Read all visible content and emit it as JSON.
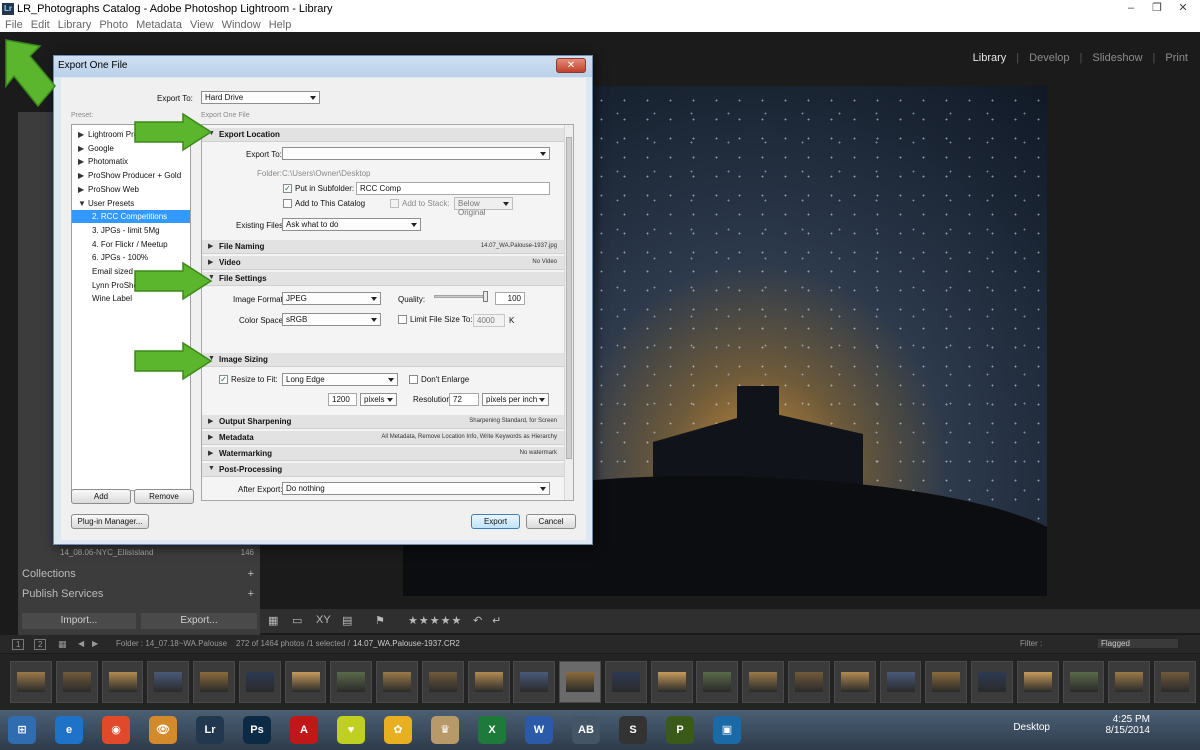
{
  "window": {
    "title": "LR_Photographs Catalog - Adobe Photoshop Lightroom - Library",
    "app_icon": "Lr",
    "controls": [
      "–",
      "❐",
      "✕"
    ]
  },
  "menubar": [
    "File",
    "Edit",
    "Library",
    "Photo",
    "Metadata",
    "View",
    "Window",
    "Help"
  ],
  "modules": {
    "items": [
      "Library",
      "Develop",
      "Slideshow",
      "Print"
    ],
    "active": "Library"
  },
  "left_panel": {
    "folder_name": "14_08.06-NYC_EllisIsland",
    "folder_count": "146",
    "collections_label": "Collections",
    "publish_label": "Publish Services",
    "import_label": "Import...",
    "export_label": "Export..."
  },
  "toolbar": {
    "rating": "★★★★★"
  },
  "filmstrip": {
    "page1": "1",
    "page2": "2",
    "source": "Folder : 14_07.18~WA.Palouse",
    "info": "272 of 1464 photos /1 selected /",
    "selected_file": "14.07_WA.Palouse-1937.CR2",
    "filter_label": "Filter :",
    "filter_value": "Flagged",
    "thumb_count": 26
  },
  "dialog": {
    "title": "Export One File",
    "close": "✕",
    "export_to_label": "Export To:",
    "export_to_value": "Hard Drive",
    "preset_label": "Preset:",
    "settings_caption": "Export One File",
    "presets": [
      {
        "label": "Lightroom Presets",
        "tri": "▶",
        "level": 0
      },
      {
        "label": "Google",
        "tri": "▶",
        "level": 0
      },
      {
        "label": "Photomatix",
        "tri": "▶",
        "level": 0
      },
      {
        "label": "ProShow Producer + Gold",
        "tri": "▶",
        "level": 0
      },
      {
        "label": "ProShow Web",
        "tri": "▶",
        "level": 0
      },
      {
        "label": "User Presets",
        "tri": "▼",
        "level": 0
      },
      {
        "label": "2. RCC Competitions",
        "tri": "",
        "level": 1,
        "selected": true
      },
      {
        "label": "3. JPGs - limit 5Mg",
        "tri": "",
        "level": 1
      },
      {
        "label": "4. For Flickr / Meetup",
        "tri": "",
        "level": 1
      },
      {
        "label": "6. JPGs - 100%",
        "tri": "",
        "level": 1
      },
      {
        "label": "Email sized",
        "tri": "",
        "level": 1
      },
      {
        "label": "Lynn ProShow",
        "tri": "",
        "level": 1
      },
      {
        "label": "Wine Label",
        "tri": "",
        "level": 1
      }
    ],
    "add_label": "Add",
    "remove_label": "Remove",
    "plugin_label": "Plug-in Manager...",
    "export_btn": "Export",
    "cancel_btn": "Cancel",
    "sections": {
      "export_location": {
        "title": "Export Location",
        "export_to_label": "Export To:",
        "folder_label": "Folder:",
        "folder_value": "C:\\Users\\Owner\\Desktop",
        "subfolder_label": "Put in Subfolder:",
        "subfolder_value": "RCC Comp",
        "add_catalog_label": "Add to This Catalog",
        "add_stack_label": "Add to Stack:",
        "stack_value": "Below Original",
        "existing_label": "Existing Files:",
        "existing_value": "Ask what to do"
      },
      "file_naming": {
        "title": "File Naming",
        "summary": "14.07_WA.Palouse-1937.jpg"
      },
      "video": {
        "title": "Video",
        "summary": "No Video"
      },
      "file_settings": {
        "title": "File Settings",
        "format_label": "Image Format:",
        "format_value": "JPEG",
        "quality_label": "Quality:",
        "quality_value": "100",
        "colorspace_label": "Color Space:",
        "colorspace_value": "sRGB",
        "limit_label": "Limit File Size To:",
        "limit_value": "4000",
        "limit_unit": "K"
      },
      "image_sizing": {
        "title": "Image Sizing",
        "resize_label": "Resize to Fit:",
        "resize_value": "Long Edge",
        "enlarge_label": "Don't Enlarge",
        "size_value": "1200",
        "size_unit": "pixels",
        "resolution_label": "Resolution:",
        "resolution_value": "72",
        "resolution_unit": "pixels per inch"
      },
      "output_sharpening": {
        "title": "Output Sharpening",
        "summary": "Sharpening Standard, for Screen"
      },
      "metadata": {
        "title": "Metadata",
        "summary": "All Metadata, Remove Location Info, Write Keywords as Hierarchy"
      },
      "watermarking": {
        "title": "Watermarking",
        "summary": "No watermark"
      },
      "post_processing": {
        "title": "Post-Processing",
        "after_label": "After Export:",
        "after_value": "Do nothing"
      }
    }
  },
  "taskbar": {
    "desktop_label": "Desktop",
    "time": "4:25 PM",
    "date": "8/15/2014",
    "icons": [
      "⊞",
      "e",
      "◉",
      "👁",
      "Lr",
      "Ps",
      "A",
      "♥",
      "✿",
      "♛",
      "X",
      "W",
      "AB",
      "S",
      "P",
      "▣"
    ]
  },
  "colors": {
    "lightroom_bg": "#1b1b1b",
    "panel": "#3c3c3c",
    "dialog_bg": "#f0f0f0",
    "selection": "#3399ff",
    "annotation_arrow": "#5bb52d"
  }
}
